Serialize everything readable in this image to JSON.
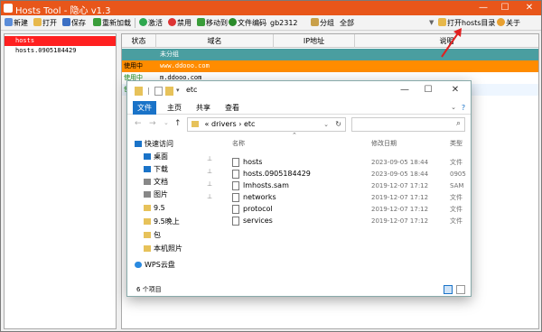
{
  "app": {
    "title": "Hosts Tool - 隐心 v1.3"
  },
  "toolbar": {
    "items": [
      {
        "label": "新建",
        "color": "#5b8dd9"
      },
      {
        "label": "打开",
        "color": "#e7b84b"
      },
      {
        "label": "保存",
        "color": "#3b6fc4"
      },
      {
        "label": "重新加载",
        "color": "#3a9d3a"
      },
      {
        "label": "激活",
        "color": "#2fa84f"
      },
      {
        "label": "禁用",
        "color": "#d33"
      },
      {
        "label": "移动到",
        "color": "#3a9d3a"
      },
      {
        "label": "文件编码",
        "color": "#2a8a2a"
      }
    ],
    "encoding_value": "gb2312",
    "group_label": "分组",
    "group_value": "全部",
    "open_dir_label": "打开hosts目录",
    "about_label": "关于"
  },
  "groups": [
    "hosts",
    "hosts.0905184429"
  ],
  "table": {
    "headers": [
      "状态",
      "域名",
      "IP地址",
      "说明"
    ],
    "rows": [
      {
        "status": "",
        "domain": "未分组",
        "ip": "",
        "note": ""
      },
      {
        "status": "使用中",
        "domain": "www.ddooo.com",
        "ip": "",
        "note": ""
      },
      {
        "status": "使用中",
        "domain": "m.ddooo.com",
        "ip": "",
        "note": ""
      },
      {
        "status": "使用",
        "domain": "",
        "ip": "",
        "note": ""
      }
    ]
  },
  "explorer": {
    "title": "etc",
    "tabs": [
      "文件",
      "主页",
      "共享",
      "查看"
    ],
    "breadcrumb": [
      "«",
      "drivers",
      "›",
      "etc"
    ],
    "nav": [
      {
        "label": "快速访问",
        "color": "#1a73c8"
      },
      {
        "label": "桌面",
        "color": "#1a73c8"
      },
      {
        "label": "下载",
        "color": "#1a73c8"
      },
      {
        "label": "文档",
        "color": "#666"
      },
      {
        "label": "图片",
        "color": "#666"
      },
      {
        "label": "9.5",
        "color": "#e7c25a"
      },
      {
        "label": "9.5晚上",
        "color": "#e7c25a"
      },
      {
        "label": "包",
        "color": "#e7c25a"
      },
      {
        "label": "本机照片",
        "color": "#e7c25a"
      },
      {
        "label": "WPS云盘",
        "color": "#2a8ae0"
      }
    ],
    "columns": [
      "名称",
      "修改日期",
      "类型"
    ],
    "files": [
      {
        "name": "hosts",
        "date": "2023-09-05 18:44",
        "type": "文件"
      },
      {
        "name": "hosts.0905184429",
        "date": "2023-09-05 18:44",
        "type": "0905"
      },
      {
        "name": "lmhosts.sam",
        "date": "2019-12-07 17:12",
        "type": "SAM"
      },
      {
        "name": "networks",
        "date": "2019-12-07 17:12",
        "type": "文件"
      },
      {
        "name": "protocol",
        "date": "2019-12-07 17:12",
        "type": "文件"
      },
      {
        "name": "services",
        "date": "2019-12-07 17:12",
        "type": "文件"
      }
    ],
    "status": "6 个项目"
  },
  "colors": {
    "titlebar": "#e8561a",
    "selected_group": "#ff2020",
    "row_orange": "#ff8c00",
    "row_teal": "#4a9ea0",
    "accent": "#1a73c8"
  }
}
